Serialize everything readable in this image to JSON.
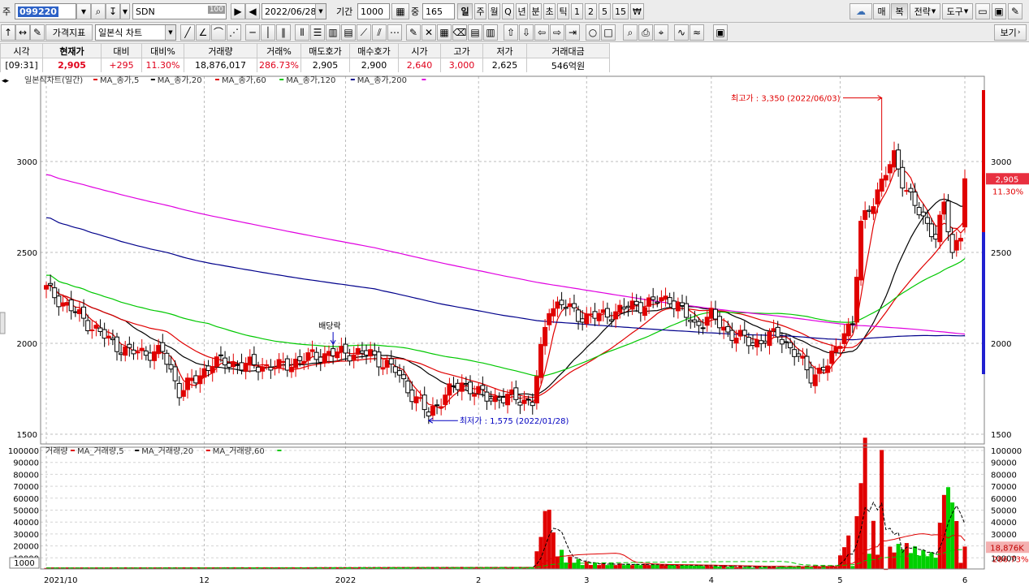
{
  "toolbar": {
    "code_prefix": "주",
    "code": "099220",
    "name": "SDN",
    "name_badge": "100",
    "date": "2022/06/28",
    "period_label": "기간",
    "period_value": "1000",
    "count_label": "중",
    "count_value": "165",
    "intervals": [
      "일",
      "주",
      "월",
      "Q",
      "년",
      "분",
      "초",
      "틱",
      "1",
      "2",
      "5",
      "15",
      "₩"
    ],
    "right_buttons": [
      "매",
      "복",
      "전략",
      "도구"
    ]
  },
  "toolbar2": {
    "indicator_label": "가격지표",
    "chart_type": "일본식 차트",
    "view_label": "보기"
  },
  "quote": {
    "headers": [
      "시각",
      "현재가",
      "대비",
      "대비%",
      "거래량",
      "거래%",
      "매도호가",
      "매수호가",
      "시가",
      "고가",
      "저가",
      "거래대금"
    ],
    "values": [
      "[09:31]",
      "2,905",
      "+295",
      "11.30%",
      "18,876,017",
      "286.73%",
      "2,905",
      "2,900",
      "2,640",
      "3,000",
      "2,625",
      "546억원"
    ]
  },
  "price_panel": {
    "title": "일본식차트(일간)",
    "legend": [
      {
        "name": "MA_종가,5",
        "color": "#e00000"
      },
      {
        "name": "MA_종가,20",
        "color": "#000000"
      },
      {
        "name": "MA_종가,60",
        "color": "#e00000"
      },
      {
        "name": "MA_종가,120",
        "color": "#00c800"
      },
      {
        "name": "MA_종가,200",
        "color": "#00008b"
      },
      {
        "name": "",
        "color": "#e000e0"
      }
    ],
    "ann_high": "최고가 : 3,350 (2022/06/03)",
    "ann_low": "최저가 : 1,575 (2022/01/28)",
    "ann_dividend": "배당락",
    "current_price": "2,905",
    "current_pct": "11.30%"
  },
  "volume_panel": {
    "title": "거래량",
    "legend": [
      {
        "name": "MA_거래량,5",
        "color": "#e00000"
      },
      {
        "name": "MA_거래량,20",
        "color": "#000000"
      },
      {
        "name": "MA_거래량,60",
        "color": "#e00000"
      },
      {
        "name": "",
        "color": "#00c800"
      }
    ],
    "unit_badge": "1000",
    "current_volume": "18,876K",
    "current_pct": "286.73%"
  },
  "chart_data": {
    "type": "candlestick",
    "price_axis": {
      "min": 1500,
      "max": 3000,
      "ticks": [
        1500,
        2000,
        2500,
        3000
      ]
    },
    "volume_axis": {
      "min": 0,
      "max": 100000,
      "ticks": [
        10000,
        20000,
        30000,
        40000,
        50000,
        60000,
        70000,
        80000,
        90000,
        100000
      ]
    },
    "x_ticks": [
      "2021/10",
      "12",
      "2022",
      "2",
      "3",
      "4",
      "5",
      "6"
    ],
    "grid": true,
    "keypoints": [
      {
        "i": 0,
        "c": 2300
      },
      {
        "i": 8,
        "c": 2150
      },
      {
        "i": 16,
        "c": 2000
      },
      {
        "i": 20,
        "c": 1950
      },
      {
        "i": 28,
        "c": 1950
      },
      {
        "i": 32,
        "c": 1740
      },
      {
        "i": 36,
        "c": 1800
      },
      {
        "i": 40,
        "c": 1900
      },
      {
        "i": 48,
        "c": 1880
      },
      {
        "i": 56,
        "c": 1870
      },
      {
        "i": 64,
        "c": 1930
      },
      {
        "i": 72,
        "c": 1950
      },
      {
        "i": 78,
        "c": 1940
      },
      {
        "i": 84,
        "c": 1850
      },
      {
        "i": 88,
        "c": 1720
      },
      {
        "i": 92,
        "c": 1610
      },
      {
        "i": 96,
        "c": 1720
      },
      {
        "i": 100,
        "c": 1780
      },
      {
        "i": 106,
        "c": 1700
      },
      {
        "i": 112,
        "c": 1700
      },
      {
        "i": 117,
        "c": 1680
      },
      {
        "i": 119,
        "c": 1950
      },
      {
        "i": 121,
        "c": 2200
      },
      {
        "i": 124,
        "c": 2220
      },
      {
        "i": 128,
        "c": 2150
      },
      {
        "i": 134,
        "c": 2150
      },
      {
        "i": 140,
        "c": 2200
      },
      {
        "i": 145,
        "c": 2220
      },
      {
        "i": 150,
        "c": 2250
      },
      {
        "i": 156,
        "c": 2100
      },
      {
        "i": 160,
        "c": 2150
      },
      {
        "i": 164,
        "c": 2060
      },
      {
        "i": 170,
        "c": 2000
      },
      {
        "i": 176,
        "c": 2050
      },
      {
        "i": 180,
        "c": 1950
      },
      {
        "i": 184,
        "c": 1820
      },
      {
        "i": 188,
        "c": 1880
      },
      {
        "i": 190,
        "c": 1960
      },
      {
        "i": 192,
        "c": 2080
      },
      {
        "i": 194,
        "c": 2100
      },
      {
        "i": 196,
        "c": 2650
      },
      {
        "i": 198,
        "c": 2750
      },
      {
        "i": 201,
        "c": 2880
      },
      {
        "i": 204,
        "c": 3030
      },
      {
        "i": 206,
        "c": 2900
      },
      {
        "i": 209,
        "c": 2750
      },
      {
        "i": 212,
        "c": 2650
      },
      {
        "i": 214,
        "c": 2600
      },
      {
        "i": 216,
        "c": 2750
      },
      {
        "i": 218,
        "c": 2500
      },
      {
        "i": 220,
        "c": 2600
      },
      {
        "i": 221,
        "c": 2905
      }
    ],
    "volume_keypoints": [
      {
        "i": 0,
        "v": 1500
      },
      {
        "i": 117,
        "v": 2000
      },
      {
        "i": 119,
        "v": 28000
      },
      {
        "i": 121,
        "v": 57000
      },
      {
        "i": 122,
        "v": 18000
      },
      {
        "i": 125,
        "v": 10000
      },
      {
        "i": 130,
        "v": 5000
      },
      {
        "i": 150,
        "v": 4000
      },
      {
        "i": 170,
        "v": 2500
      },
      {
        "i": 190,
        "v": 3000
      },
      {
        "i": 193,
        "v": 28000
      },
      {
        "i": 194,
        "v": 10000
      },
      {
        "i": 196,
        "v": 75000
      },
      {
        "i": 197,
        "v": 93000
      },
      {
        "i": 198,
        "v": 35000
      },
      {
        "i": 199,
        "v": 33000
      },
      {
        "i": 200,
        "v": 20000
      },
      {
        "i": 201,
        "v": 96000
      },
      {
        "i": 202,
        "v": 15000
      },
      {
        "i": 206,
        "v": 20000
      },
      {
        "i": 210,
        "v": 15000
      },
      {
        "i": 214,
        "v": 12000
      },
      {
        "i": 216,
        "v": 64000
      },
      {
        "i": 218,
        "v": 62000
      },
      {
        "i": 220,
        "v": 10000
      },
      {
        "i": 221,
        "v": 18876
      }
    ],
    "high": {
      "price": 3350,
      "date": "2022/06/03"
    },
    "low": {
      "price": 1575,
      "date": "2022/01/28"
    }
  }
}
